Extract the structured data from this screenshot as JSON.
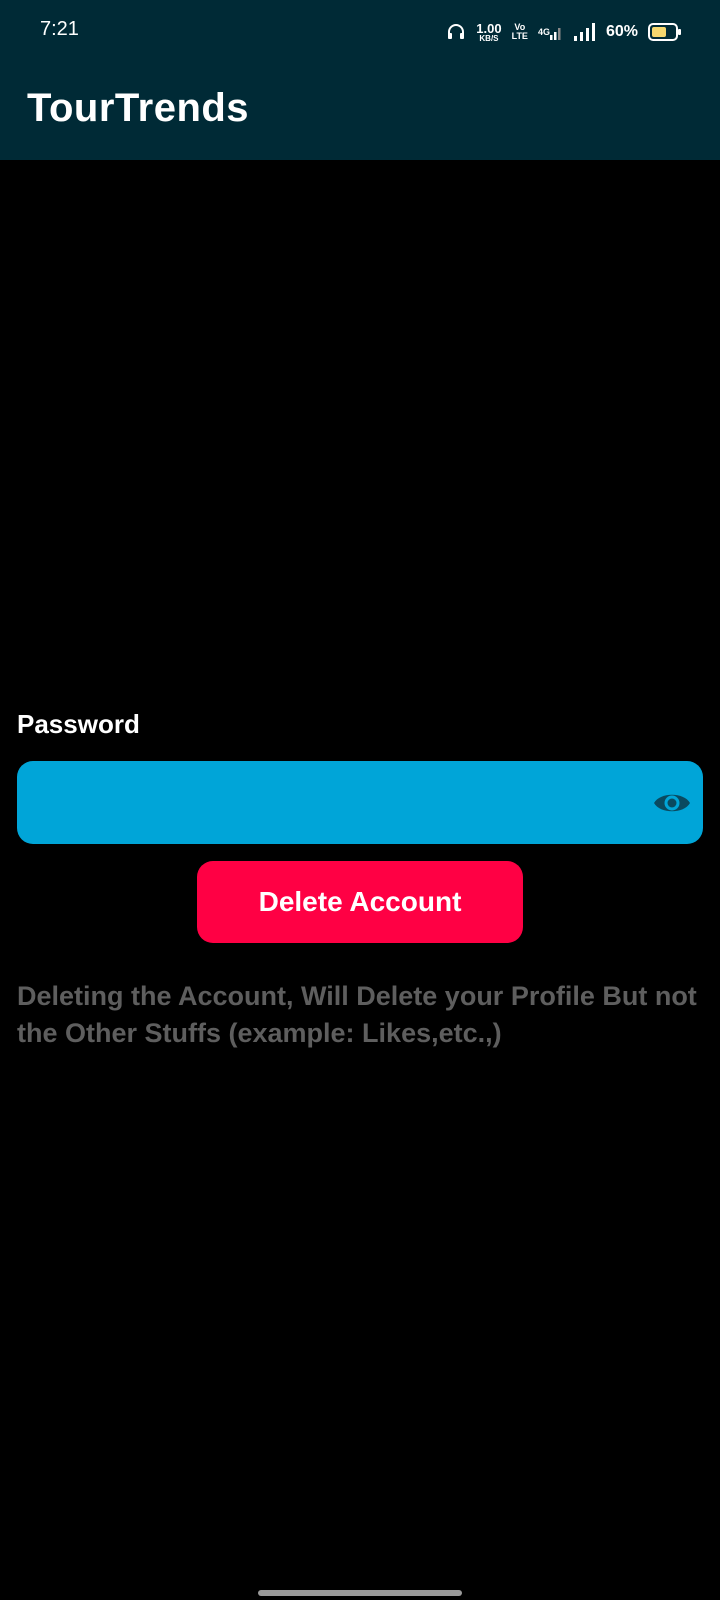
{
  "status_bar": {
    "time": "7:21",
    "net_speed_value": "1.00",
    "net_speed_unit": "KB/S",
    "volte_top": "Vo",
    "volte_bottom": "LTE",
    "network_type": "4G",
    "battery_percent": "60%",
    "icons": [
      "headphones-icon",
      "volte-icon",
      "signal-4g-icon",
      "signal-icon",
      "battery-icon"
    ]
  },
  "app_bar": {
    "title": "TourTrends"
  },
  "form": {
    "password_label": "Password",
    "password_value": "",
    "toggle_icon": "eye-icon",
    "delete_button_label": "Delete Account",
    "note": "Deleting the Account, Will Delete your Profile But not the Other Stuffs (example: Likes,etc.,)"
  },
  "colors": {
    "app_bar_bg": "#002a36",
    "field_bg": "#00a5d8",
    "button_bg": "#ff0044",
    "note_text": "#5e5e5e",
    "battery_fill": "#f5d76e"
  }
}
